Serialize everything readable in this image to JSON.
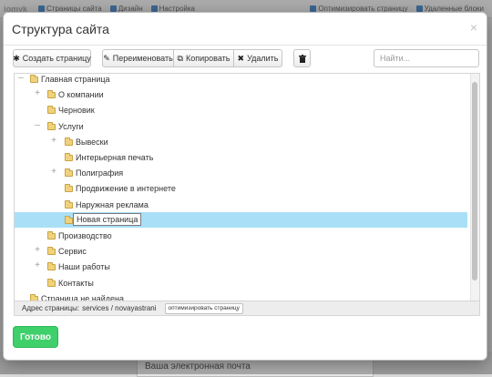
{
  "background": {
    "logo": "iomyk",
    "topbar_items": [
      "Страницы сайта",
      "Дизайн",
      "Настройка"
    ],
    "topbar_right": [
      "Оптимизировать страницу",
      "Удаленные блоки"
    ],
    "bottom_field": "Ваша электронная почта"
  },
  "modal": {
    "title": "Структура сайта",
    "close": "×"
  },
  "toolbar": {
    "create": "Создать страницу",
    "rename": "Переименовать",
    "copy": "Копировать",
    "delete": "Удалить",
    "search_placeholder": "Найти..."
  },
  "tree": {
    "items": [
      {
        "label": "Главная страница",
        "level": 0,
        "toggle": "–"
      },
      {
        "label": "О компании",
        "level": 1,
        "toggle": "+"
      },
      {
        "label": "Черновик",
        "level": 1,
        "toggle": ""
      },
      {
        "label": "Услуги",
        "level": 1,
        "toggle": "–"
      },
      {
        "label": "Вывески",
        "level": 2,
        "toggle": "+"
      },
      {
        "label": "Интерьерная печать",
        "level": 2,
        "toggle": ""
      },
      {
        "label": "Полиграфия",
        "level": 2,
        "toggle": "+"
      },
      {
        "label": "Продвижение в интернете",
        "level": 2,
        "toggle": ""
      },
      {
        "label": "Наружная реклама",
        "level": 2,
        "toggle": ""
      },
      {
        "label": "Новая страница",
        "level": 2,
        "toggle": "",
        "selected": true,
        "editing": true
      },
      {
        "label": "Производство",
        "level": 1,
        "toggle": ""
      },
      {
        "label": "Сервис",
        "level": 1,
        "toggle": "+"
      },
      {
        "label": "Наши работы",
        "level": 1,
        "toggle": "+"
      },
      {
        "label": "Контакты",
        "level": 1,
        "toggle": ""
      },
      {
        "label": "Страница не найдена",
        "level": 0,
        "toggle": ""
      }
    ]
  },
  "address": {
    "label": "Адрес страницы:",
    "path": "services / novayastrani",
    "optimize_button": "оптимизировать страницу"
  },
  "footer": {
    "done": "Готово"
  }
}
